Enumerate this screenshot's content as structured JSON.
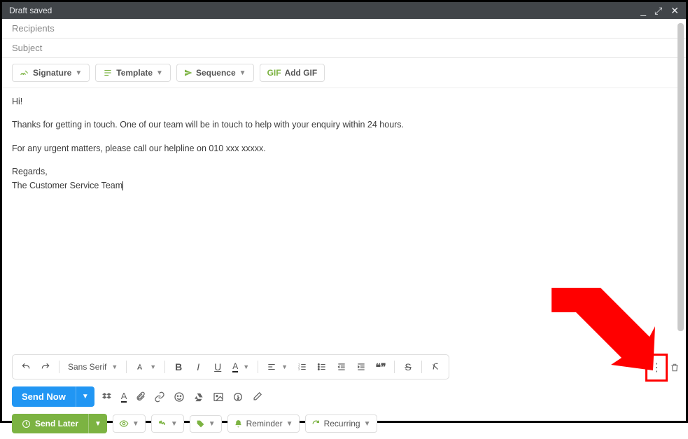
{
  "header": {
    "title": "Draft saved"
  },
  "fields": {
    "recipients_placeholder": "Recipients",
    "subject_placeholder": "Subject"
  },
  "actions": {
    "signature": "Signature",
    "template": "Template",
    "sequence": "Sequence",
    "add_gif": "Add GIF",
    "gif_prefix": "GIF"
  },
  "body": {
    "line1": "Hi!",
    "line2": "Thanks for getting in touch. One of our team will be in touch to help with your enquiry within 24 hours.",
    "line3": "For any urgent matters, please call our helpline on 010 xxx xxxxx.",
    "line4": "Regards,",
    "line5": "The Customer Service Team"
  },
  "format": {
    "font": "Sans Serif"
  },
  "send": {
    "now": "Send Now",
    "later": "Send Later",
    "reminder": "Reminder",
    "recurring": "Recurring"
  },
  "accent": {
    "green": "#7cb342",
    "blue": "#2196f3",
    "red": "#ff0000"
  }
}
